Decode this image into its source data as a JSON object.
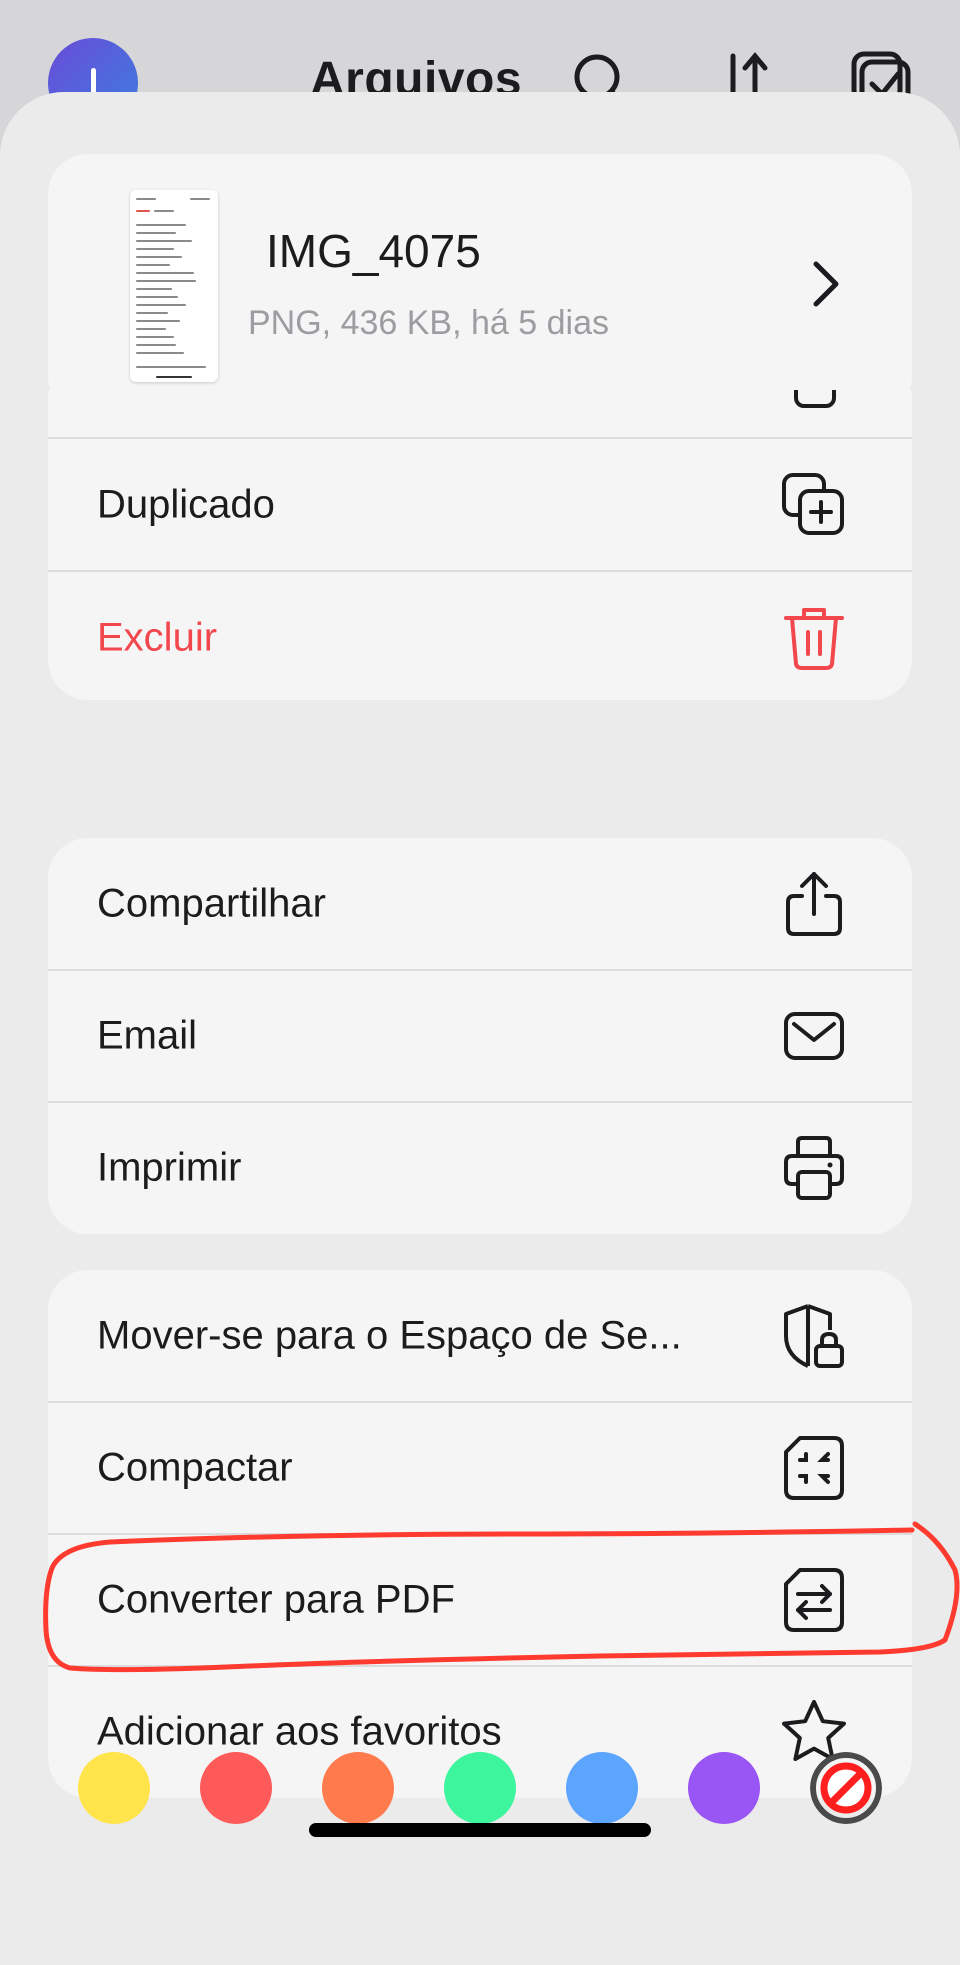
{
  "background": {
    "title": "Arquivos"
  },
  "file": {
    "name": "IMG_4075",
    "meta": "PNG, 436 KB, há 5 dias"
  },
  "menu": {
    "group1": [
      {
        "label": "Duplicado",
        "icon": "duplicate-icon"
      },
      {
        "label": "Excluir",
        "icon": "trash-icon",
        "danger": true
      }
    ],
    "group2": [
      {
        "label": "Compartilhar",
        "icon": "share-icon"
      },
      {
        "label": "Email",
        "icon": "mail-icon"
      },
      {
        "label": "Imprimir",
        "icon": "printer-icon"
      }
    ],
    "group3": [
      {
        "label": "Mover-se para o Espaço de Se...",
        "icon": "secure-shield-lock-icon"
      },
      {
        "label": "Compactar",
        "icon": "compress-icon"
      },
      {
        "label": "Converter para PDF",
        "icon": "convert-icon"
      },
      {
        "label": "Adicionar aos favoritos",
        "icon": "star-icon"
      }
    ]
  },
  "color_tags": [
    {
      "name": "yellow",
      "color": "#ffe44c"
    },
    {
      "name": "red",
      "color": "#ff5a5a"
    },
    {
      "name": "orange",
      "color": "#ff7a4c"
    },
    {
      "name": "green",
      "color": "#3cf59c"
    },
    {
      "name": "blue",
      "color": "#5ca5ff"
    },
    {
      "name": "purple",
      "color": "#9a56f5"
    },
    {
      "name": "none",
      "color": "#ff1f1f"
    }
  ],
  "colors": {
    "danger": "#f2474c",
    "annotation": "#ff3b30",
    "sheet_bg": "#ebebec",
    "card_bg": "#f5f5f6"
  }
}
